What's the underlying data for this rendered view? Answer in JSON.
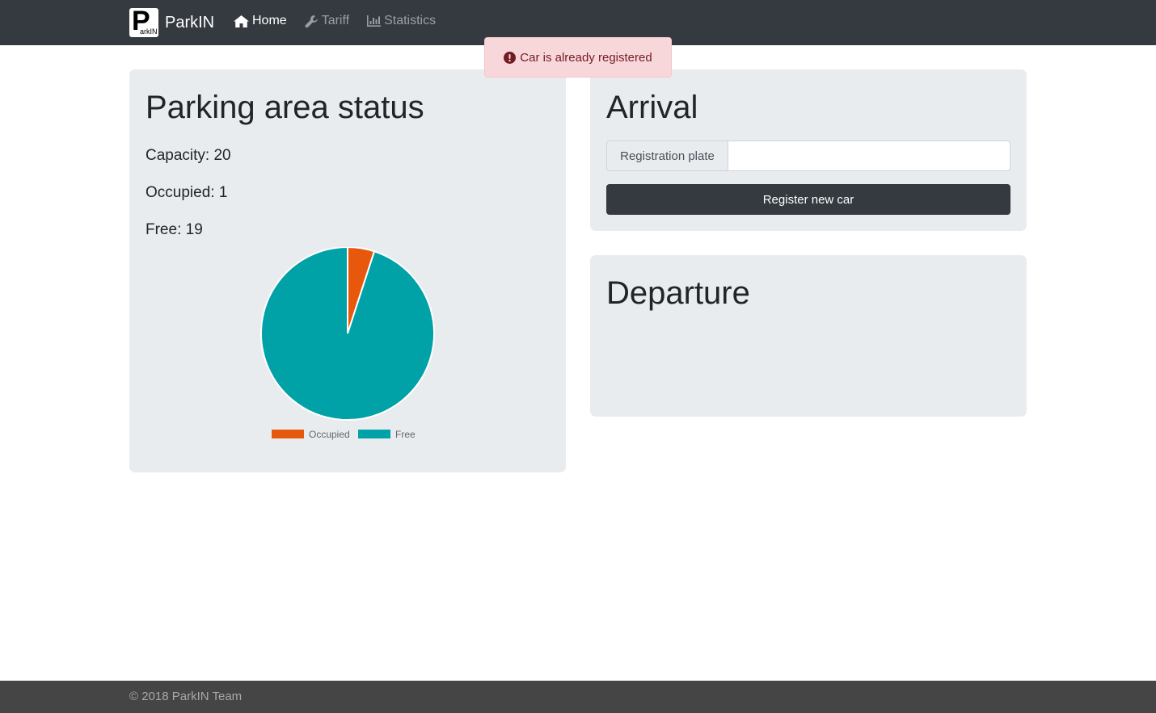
{
  "navbar": {
    "brand_name": "ParkIN",
    "logo_letter": "P",
    "logo_small_text": "arkIN",
    "items": [
      {
        "label": "Home",
        "icon": "home-icon",
        "active": true
      },
      {
        "label": "Tariff",
        "icon": "wrench-icon",
        "active": false
      },
      {
        "label": "Statistics",
        "icon": "bar-chart-icon",
        "active": false
      }
    ]
  },
  "alert": {
    "icon": "exclamation-circle-icon",
    "message": "Car is already registered"
  },
  "status": {
    "title": "Parking area status",
    "capacity_label": "Capacity: ",
    "capacity_value": "20",
    "occupied_label": "Occupied: ",
    "occupied_value": "1",
    "free_label": "Free: ",
    "free_value": "19"
  },
  "chart_data": {
    "type": "pie",
    "categories": [
      "Occupied",
      "Free"
    ],
    "values": [
      1,
      19
    ],
    "colors": [
      "#e8580c",
      "#00a2a7"
    ],
    "legend_position": "bottom"
  },
  "arrival": {
    "title": "Arrival",
    "input_label": "Registration plate",
    "input_value": "",
    "input_placeholder": "",
    "button_label": "Register new car"
  },
  "departure": {
    "title": "Departure"
  },
  "footer": {
    "text": "© 2018 ParkIN Team"
  }
}
